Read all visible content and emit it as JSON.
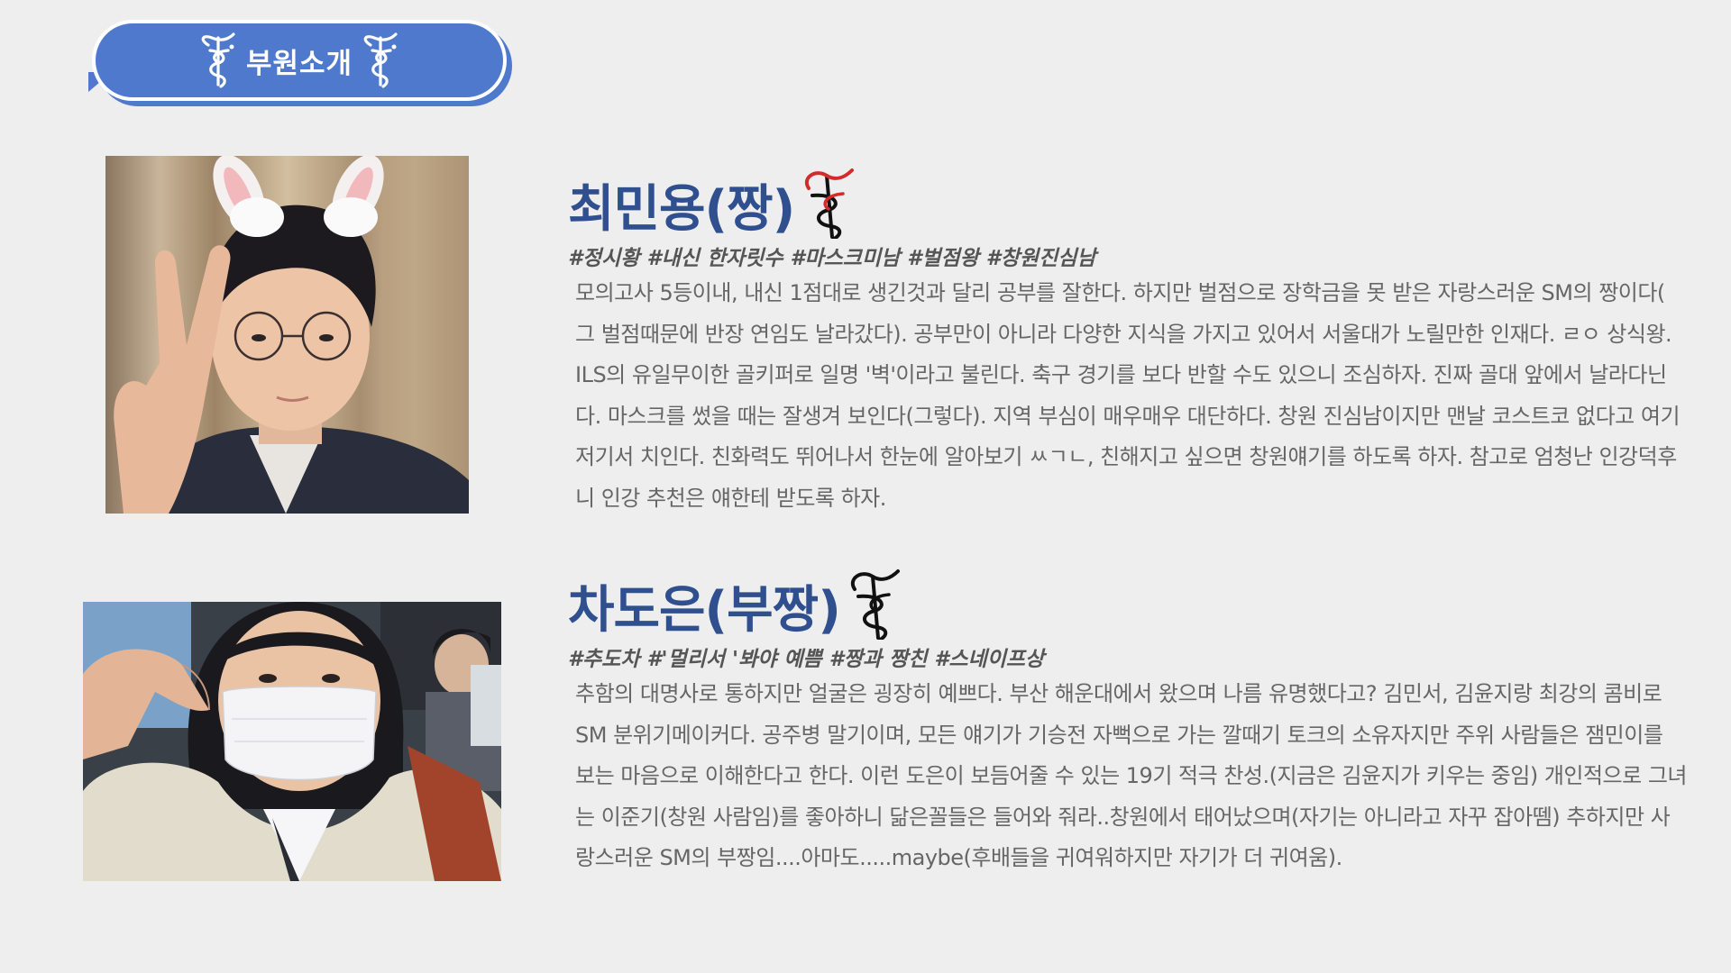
{
  "header": {
    "title": "부원소개",
    "accent_color": "#4f79cc",
    "icon_left": "caduceus-icon",
    "icon_right": "caduceus-icon"
  },
  "members": [
    {
      "name": "최민용(짱)",
      "name_color": "#2f4f8e",
      "name_icon": "caduceus-red-icon",
      "tags": "#정시황 #내신 한자릿수 #마스크미남  #벌점왕 #창원진심남",
      "bio": "모의고사 5등이내, 내신 1점대로 생긴것과 달리 공부를 잘한다. 하지만 벌점으로 장학금을 못 받은 자랑스러운 SM의 짱이다( 그 벌점때문에 반장 연임도 날라갔다). 공부만이 아니라 다양한 지식을 가지고 있어서 서울대가 노릴만한 인재다. ㄹㅇ 상식왕. ILS의 유일무이한 골키퍼로 일명 '벽'이라고 불린다.  축구 경기를 보다 반할 수도 있으니 조심하자.  진짜 골대 앞에서 날라다닌다. 마스크를 썼을 때는 잘생겨 보인다(그렇다). 지역 부심이 매우매우 대단하다. 창원 진심남이지만 맨날 코스트코 없다고 여기저기서 치인다. 친화력도 뛰어나서 한눈에 알아보기 ㅆㄱㄴ, 친해지고 싶으면 창원얘기를 하도록 하자.  참고로 엄청난 인강덕후니 인강 추천은 얘한테 받도록 하자.",
      "photo": "member-photo-with-bunny-ears"
    },
    {
      "name": "차도은(부짱)",
      "name_color": "#2f4f8e",
      "name_icon": "caduceus-icon",
      "tags": "#추도차 #'멀리서 '봐야 예쁨  #짱과 짱친 #스네이프상",
      "bio": "추함의 대명사로 통하지만 얼굴은 굉장히 예쁘다.  부산 해운대에서 왔으며 나름 유명했다고?  김민서, 김윤지랑 최강의 콤비로 SM 분위기메이커다.  공주병 말기이며, 모든 얘기가 기승전 자뻑으로 가는 깔때기 토크의 소유자지만 주위 사람들은 잼민이를 보는 마음으로 이해한다고 한다. 이런 도은이 보듬어줄 수 있는 19기 적극 찬성.(지금은 김윤지가 키우는 중임) 개인적으로 그녀는 이준기(창원 사람임)를 좋아하니 닮은꼴들은 들어와 줘라..창원에서 태어났으며(자기는 아니라고 자꾸 잡아뗌) 추하지만 사랑스러운 SM의 부짱임....아마도.....maybe(후배들을 귀여워하지만 자기가 더 귀여움).",
      "photo": "member-photo-with-mask"
    }
  ]
}
